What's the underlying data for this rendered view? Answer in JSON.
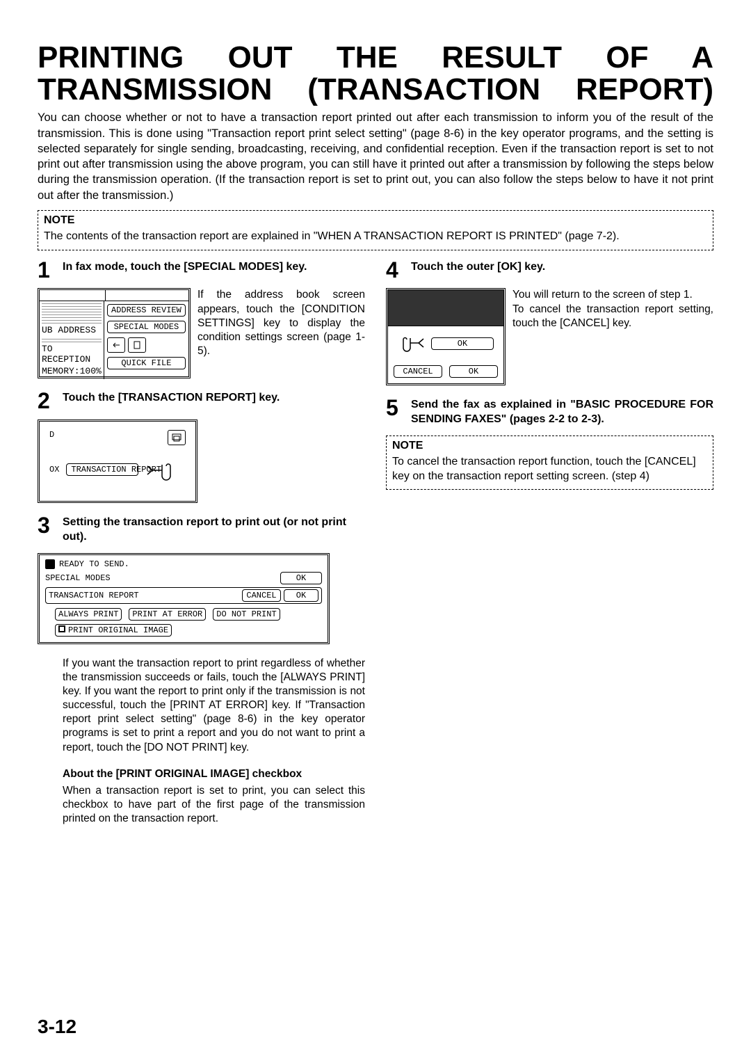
{
  "title_line1": "PRINTING OUT THE RESULT OF A",
  "title_line2": "TRANSMISSION (TRANSACTION REPORT)",
  "intro": "You can choose whether or not to have a transaction report printed out after each transmission to inform you of the result of the transmission. This is done using \"Transaction report print select setting\" (page 8-6) in the key operator programs, and the setting is selected separately for single sending, broadcasting, receiving, and confidential reception. Even if the transaction report is set to not print out after transmission using the above program, you can still have it printed out after a transmission by following the steps below during the transmission operation. (If the transaction report is set to print out, you can also follow the steps below to have it not print out after the transmission.)",
  "note1": {
    "title": "NOTE",
    "body": "The contents of the transaction report are explained in \"WHEN A TRANSACTION REPORT IS PRINTED\" (page 7-2)."
  },
  "steps": {
    "s1": {
      "num": "1",
      "title": "In fax mode, touch the [SPECIAL MODES] key.",
      "side": "If the address book screen appears, touch the [CONDITION SETTINGS] key to display the condition settings screen (page 1-5)."
    },
    "s2": {
      "num": "2",
      "title": "Touch the [TRANSACTION REPORT] key."
    },
    "s3": {
      "num": "3",
      "title": "Setting the transaction report to print out (or not print out).",
      "para": "If you want the transaction report to print regardless of whether the transmission succeeds or fails, touch the [ALWAYS PRINT] key. If you want the report to print only if the transmission is not successful, touch the [PRINT AT ERROR] key. If \"Transaction report print select setting\" (page 8-6) in the key operator programs is set to print a report and you do not want to print a report, touch the [DO NOT PRINT] key.",
      "subhead": "About the [PRINT ORIGINAL IMAGE] checkbox",
      "para2": "When a transaction report is set to print, you can select this checkbox to have part of the first page of the transmission printed on the transaction report."
    },
    "s4": {
      "num": "4",
      "title": "Touch the outer [OK] key.",
      "side": "You will return to the screen of step 1.",
      "side2": "To cancel the transaction report setting, touch the [CANCEL] key."
    },
    "s5": {
      "num": "5",
      "title": "Send the fax as explained in \"BASIC PROCEDURE FOR SENDING FAXES\" (pages 2-2 to 2-3)."
    }
  },
  "note2": {
    "title": "NOTE",
    "body": "To cancel the transaction report function, touch the [CANCEL] key on the transaction report setting screen. (step 4)"
  },
  "panel1": {
    "tab": "",
    "sub_address": "UB ADDRESS",
    "to_reception": "TO RECEPTION",
    "memory": "MEMORY:100%",
    "address_review": "ADDRESS REVIEW",
    "special_modes": "SPECIAL MODES",
    "quick_file": "QUICK FILE"
  },
  "panel2": {
    "d": "D",
    "ox": "OX",
    "trans_report": "TRANSACTION REPORT"
  },
  "panel3": {
    "ready": "READY TO SEND.",
    "special_modes": "SPECIAL MODES",
    "ok1": "OK",
    "trans_report": "TRANSACTION REPORT",
    "cancel": "CANCEL",
    "ok2": "OK",
    "always": "ALWAYS PRINT",
    "at_error": "PRINT AT ERROR",
    "do_not": "DO NOT PRINT",
    "orig_image": "PRINT ORIGINAL IMAGE"
  },
  "panel4": {
    "ok_big": "OK",
    "cancel": "CANCEL",
    "ok_small": "OK"
  },
  "page_num": "3-12"
}
